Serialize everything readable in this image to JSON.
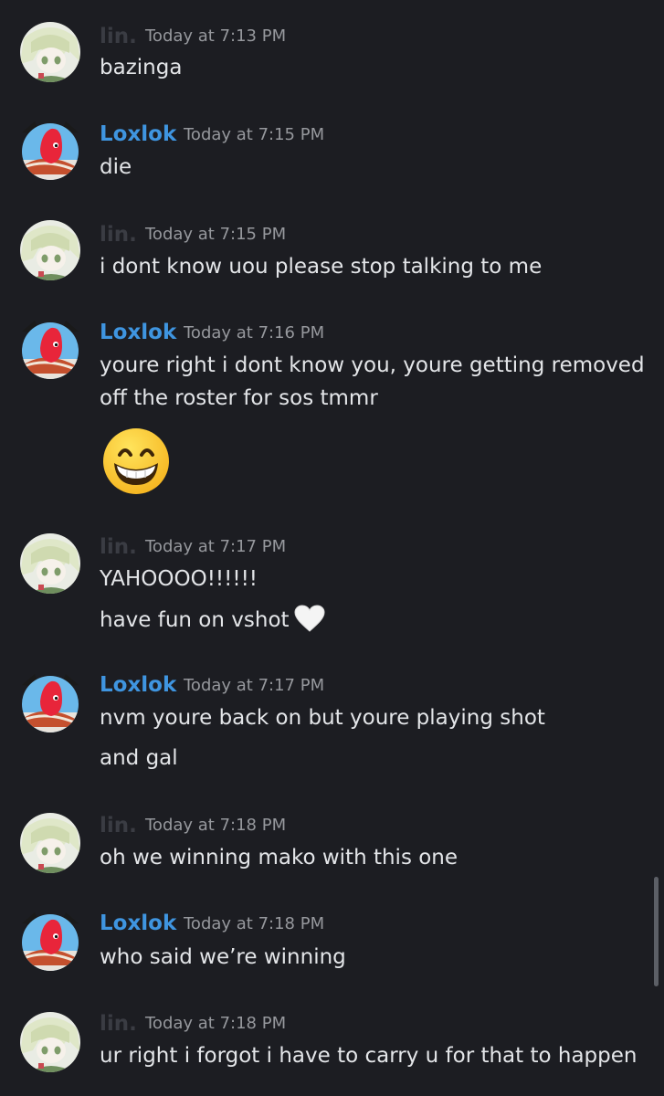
{
  "users": {
    "lin": {
      "name": "lin.",
      "color": "#3a3c43"
    },
    "loxlok": {
      "name": "Loxlok",
      "color": "#3f95e0"
    }
  },
  "messages": [
    {
      "user": "lin",
      "timestamp": "Today at 7:13 PM",
      "lines": [
        "bazinga"
      ]
    },
    {
      "user": "loxlok",
      "timestamp": "Today at 7:15 PM",
      "lines": [
        "die"
      ]
    },
    {
      "user": "lin",
      "timestamp": "Today at 7:15 PM",
      "lines": [
        "i dont know uou please stop talking to me"
      ]
    },
    {
      "user": "loxlok",
      "timestamp": "Today at 7:16 PM",
      "lines": [
        "youre right i dont know you, youre getting removed",
        "off the roster for sos tmmr"
      ],
      "emoji": "grinning-face-with-smiling-eyes"
    },
    {
      "user": "lin",
      "timestamp": "Today at 7:17 PM",
      "lines": [
        "YAHOOOO!!!!!!",
        "have fun on vshot"
      ],
      "heart": "white-heart"
    },
    {
      "user": "loxlok",
      "timestamp": "Today at 7:17 PM",
      "lines": [
        "nvm youre back on but youre playing shot",
        "and gal"
      ]
    },
    {
      "user": "lin",
      "timestamp": "Today at 7:18 PM",
      "lines": [
        "oh we winning mako with this one"
      ]
    },
    {
      "user": "loxlok",
      "timestamp": "Today at 7:18 PM",
      "lines": [
        "who said we’re winning"
      ]
    },
    {
      "user": "lin",
      "timestamp": "Today at 7:18 PM",
      "lines": [
        "ur right i forgot i have to carry u for that to happen"
      ]
    }
  ]
}
